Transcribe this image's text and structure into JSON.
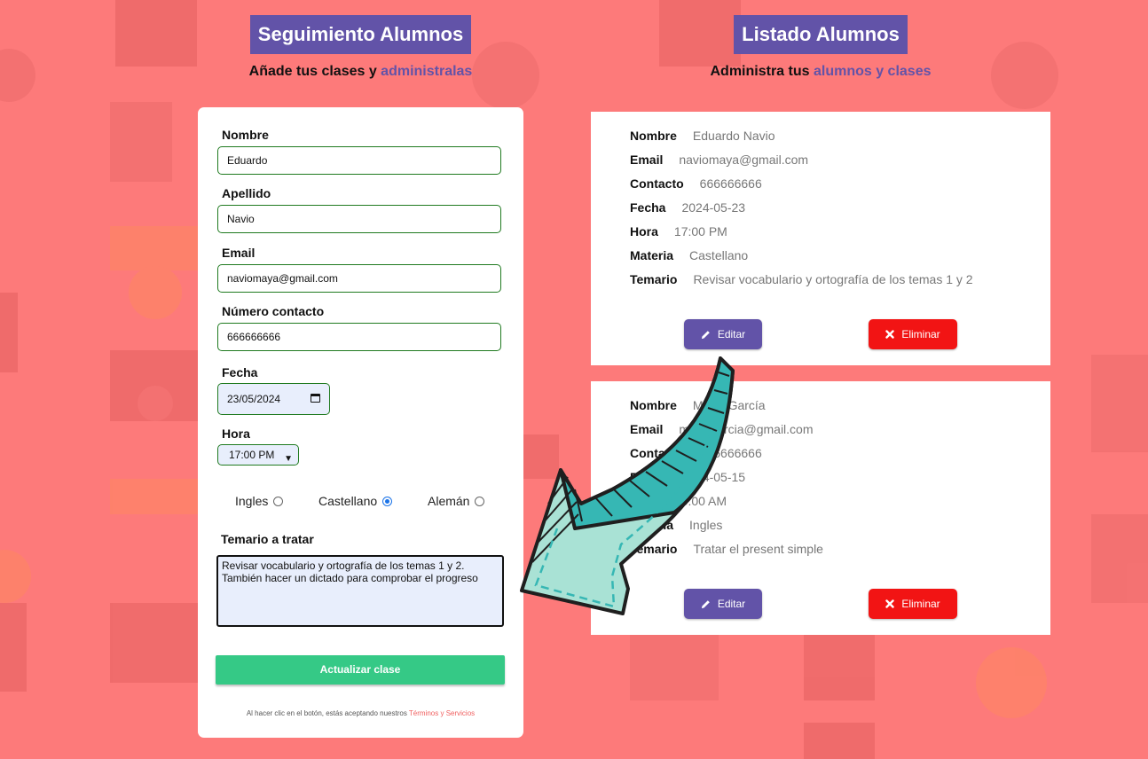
{
  "left_header": {
    "title": "Seguimiento Alumnos",
    "subtitle_plain": "Añade tus clases y ",
    "subtitle_accent": "administralas"
  },
  "right_header": {
    "title": "Listado Alumnos",
    "subtitle_plain": "Administra tus ",
    "subtitle_accent": "alumnos y clases"
  },
  "form": {
    "nombre_label": "Nombre",
    "nombre_value": "Eduardo",
    "apellido_label": "Apellido",
    "apellido_value": "Navio",
    "email_label": "Email",
    "email_value": "naviomaya@gmail.com",
    "contacto_label": "Número contacto",
    "contacto_value": "666666666",
    "fecha_label": "Fecha",
    "fecha_value": "23/05/2024",
    "hora_label": "Hora",
    "hora_value": "17:00 PM",
    "materias": [
      {
        "label": "Ingles",
        "checked": false
      },
      {
        "label": "Castellano",
        "checked": true
      },
      {
        "label": "Alemán",
        "checked": false
      }
    ],
    "temario_label": "Temario a tratar",
    "temario_value": "Revisar vocabulario y ortografía de los temas 1 y 2.\nTambién hacer un dictado para comprobar el progreso",
    "submit_label": "Actualizar clase",
    "terms_text": "Al hacer clic en el botón, estás aceptando nuestros ",
    "terms_link": "Términos y Servicios"
  },
  "cards": [
    {
      "rows": [
        {
          "key": "Nombre",
          "value": "Eduardo Navio"
        },
        {
          "key": "Email",
          "value": "naviomaya@gmail.com"
        },
        {
          "key": "Contacto",
          "value": "666666666"
        },
        {
          "key": "Fecha",
          "value": "2024-05-23"
        },
        {
          "key": "Hora",
          "value": "17:00 PM"
        },
        {
          "key": "Materia",
          "value": "Castellano"
        },
        {
          "key": "Temario",
          "value": "Revisar vocabulario y ortografía de los temas 1 y 2"
        }
      ],
      "edit_label": "Editar",
      "delete_label": "Eliminar"
    },
    {
      "rows": [
        {
          "key": "Nombre",
          "value": "María García"
        },
        {
          "key": "Email",
          "value": "mariagarcia@gmail.com"
        },
        {
          "key": "Contacto",
          "value": "666666666"
        },
        {
          "key": "Fecha",
          "value": "2024-05-15"
        },
        {
          "key": "Hora",
          "value": "10:00 AM"
        },
        {
          "key": "Materia",
          "value": "Ingles"
        },
        {
          "key": "Temario",
          "value": "Tratar el present simple"
        }
      ],
      "edit_label": "Editar",
      "delete_label": "Eliminar"
    }
  ],
  "colors": {
    "background": "#fd7a7a",
    "accent": "#6253a8",
    "submit": "#35c986",
    "delete": "#f21414",
    "arrow": "#3cc0bd"
  },
  "icons": {
    "edit": "pencil-icon",
    "delete": "x-icon",
    "calendar": "calendar-icon",
    "select": "chevron-down-icon",
    "arrow": "curved-arrow-icon"
  }
}
